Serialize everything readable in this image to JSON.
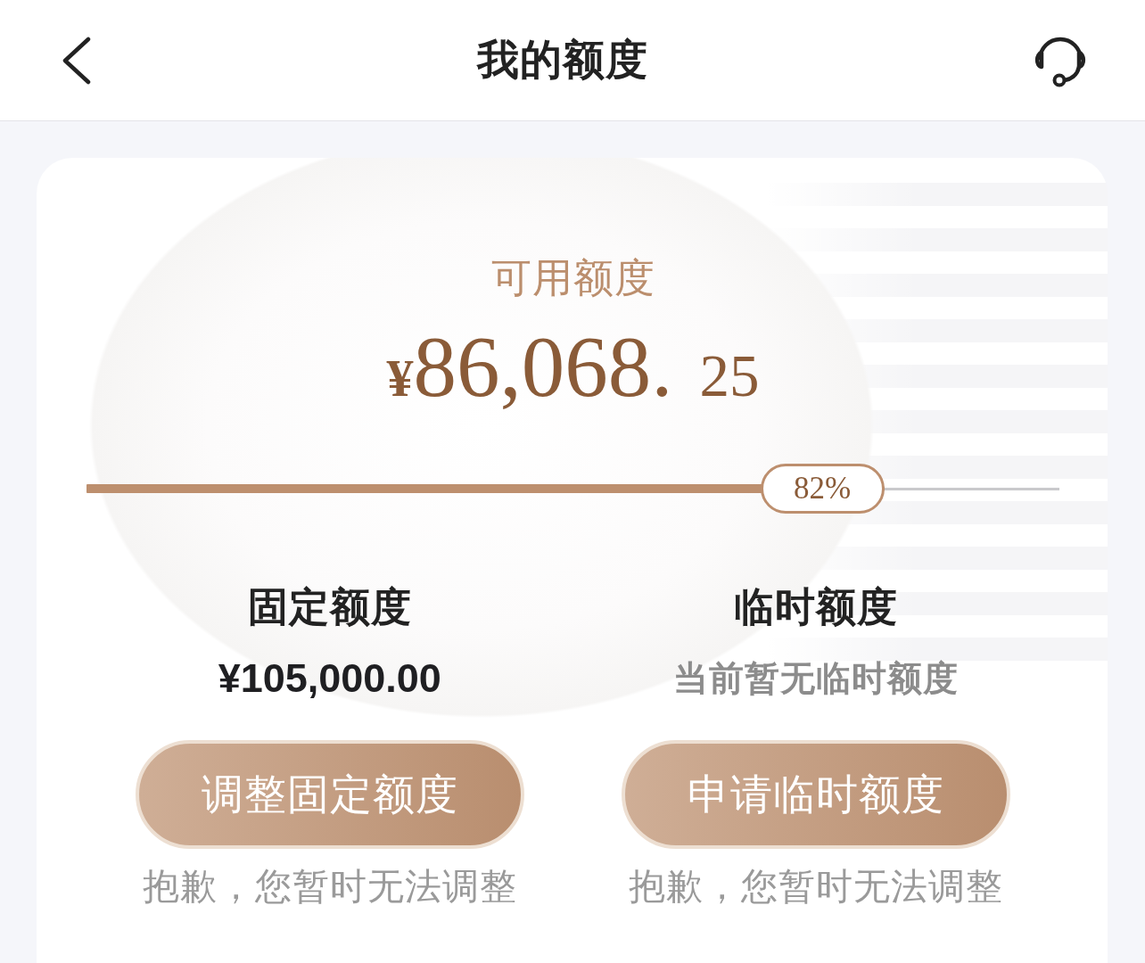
{
  "header": {
    "title": "我的额度"
  },
  "available": {
    "label": "可用额度",
    "amount": {
      "currency": "¥",
      "integer": "86,068.",
      "fraction": "25"
    }
  },
  "usage": {
    "level": 0.82,
    "percent": "82%"
  },
  "quotas": [
    {
      "title": "固定额度",
      "value": {
        "kind": "amount",
        "text": "¥105,000.00"
      },
      "button": "调整固定额度",
      "note": "抱歉，您暂时无法调整"
    },
    {
      "title": "临时额度",
      "value": {
        "kind": "message",
        "text": "当前暂无临时额度"
      },
      "button": "申请临时额度",
      "note": "抱歉，您暂时无法调整"
    }
  ]
}
